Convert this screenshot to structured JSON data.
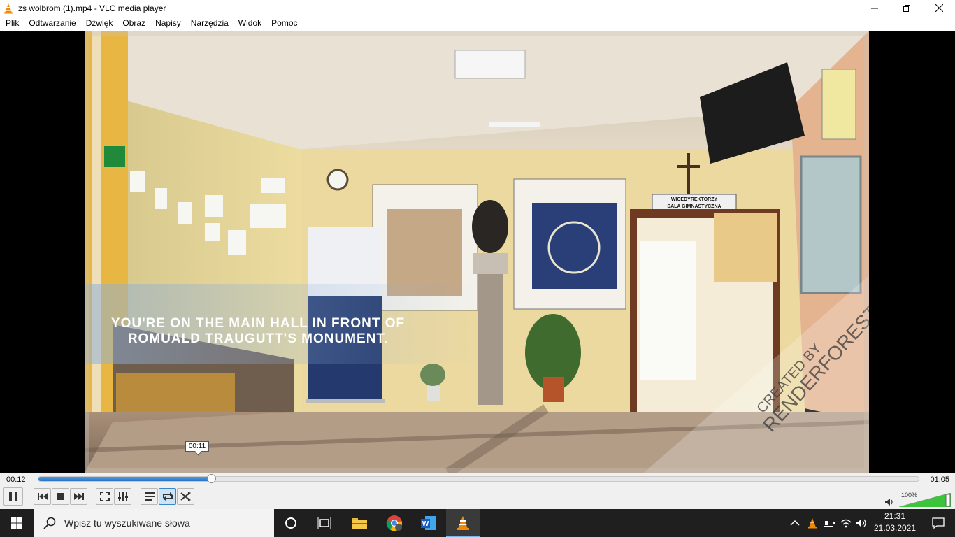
{
  "window": {
    "title": "zs wolbrom (1).mp4 - VLC media player"
  },
  "menu": [
    "Plik",
    "Odtwarzanie",
    "Dźwięk",
    "Obraz",
    "Napisy",
    "Narzędzia",
    "Widok",
    "Pomoc"
  ],
  "video": {
    "caption_line1": "YOU'RE ON THE MAIN HALL IN FRONT OF",
    "caption_line2": "ROMUALD TRAUGUTT'S MONUMENT.",
    "watermark_line1": "CREATED BY",
    "watermark_line2": "RENDERFOREST.COM",
    "sign_line1": "WICEDYREKTORZY",
    "sign_line2": "SALA GIMNASTYCZNA",
    "hover_time": "00:11"
  },
  "player": {
    "current_time": "00:12",
    "total_time": "01:05",
    "progress_fraction": 0.196,
    "volume_label": "100%",
    "volume_fraction": 1.0,
    "loop_active": true
  },
  "taskbar": {
    "search_placeholder": "Wpisz tu wyszukiwane słowa",
    "time": "21:31",
    "date": "21.03.2021"
  },
  "colors": {
    "accent": "#3a86c8",
    "vlc_orange": "#f08a00",
    "taskbar": "#1f1f1f"
  }
}
